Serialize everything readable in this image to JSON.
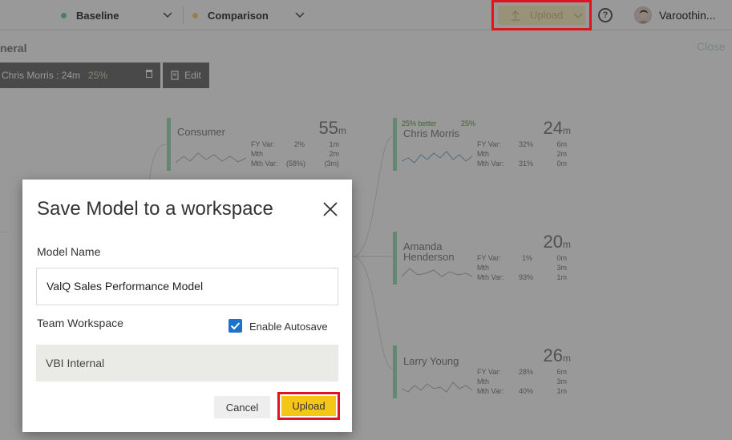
{
  "topbar": {
    "baseline_label": "Baseline",
    "comparison_label": "Comparison",
    "upload_label": "Upload",
    "help_glyph": "?",
    "user_name": "Varoothin..."
  },
  "page": {
    "section_title": "neral",
    "close_label": "Close",
    "pill_text": "Chris Morris : 24m",
    "pill_pct": "25%",
    "edit_label": "Edit"
  },
  "nodes": [
    {
      "name": "Consumer",
      "value": "55",
      "unit": "m",
      "rows": [
        {
          "label": "FY Var:",
          "mid": "2%",
          "right": "1m"
        },
        {
          "label": "Mth",
          "mid": "",
          "right": "2m"
        },
        {
          "label": "Mth Var:",
          "mid": "(58%)",
          "right": "(3m)"
        }
      ]
    },
    {
      "name": "Chris Morris",
      "value": "24",
      "unit": "m",
      "tag_better": "25% better",
      "tag_pct": "25%",
      "rows": [
        {
          "label": "FY Var:",
          "mid": "32%",
          "right": "6m"
        },
        {
          "label": "Mth",
          "mid": "",
          "right": "2m"
        },
        {
          "label": "Mth Var:",
          "mid": "31%",
          "right": "0m"
        }
      ]
    },
    {
      "name": "Amanda Henderson",
      "value": "20",
      "unit": "m",
      "rows": [
        {
          "label": "FY Var:",
          "mid": "1%",
          "right": "0m"
        },
        {
          "label": "Mth",
          "mid": "",
          "right": "3m"
        },
        {
          "label": "Mth Var:",
          "mid": "93%",
          "right": "1m"
        }
      ]
    },
    {
      "name": "Larry Young",
      "value": "26",
      "unit": "m",
      "rows": [
        {
          "label": "FY Var:",
          "mid": "28%",
          "right": "6m"
        },
        {
          "label": "Mth",
          "mid": "",
          "right": "3m"
        },
        {
          "label": "Mth Var:",
          "mid": "40%",
          "right": "1m"
        }
      ]
    }
  ],
  "dialog": {
    "title": "Save Model to a workspace",
    "model_name_label": "Model Name",
    "model_name_value": "ValQ Sales Performance Model",
    "team_workspace_label": "Team Workspace",
    "autosave_label": "Enable Autosave",
    "autosave_checked": true,
    "workspace_value": "VBI Internal",
    "cancel_label": "Cancel",
    "upload_label": "Upload"
  },
  "colors": {
    "accent_yellow": "#f5c518",
    "highlight_red": "#e0141e",
    "checkbox_blue": "#1e73c8",
    "node_border_green": "#a6e3bc"
  }
}
